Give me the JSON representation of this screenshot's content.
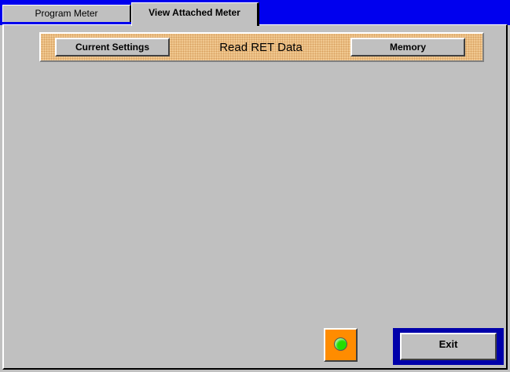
{
  "tabs": [
    {
      "label": "Program Meter",
      "active": false
    },
    {
      "label": "View Attached Meter",
      "active": true
    }
  ],
  "toolbar": {
    "current_settings_label": "Current Settings",
    "title": "Read RET Data",
    "memory_label": "Memory"
  },
  "status": {
    "led_color": "#22dd00",
    "led_box_color": "#ff8c00"
  },
  "footer": {
    "exit_label": "Exit"
  },
  "colors": {
    "tab_strip": "#0000ee",
    "panel": "#c0c0c0",
    "orange_bar": "#f0c890",
    "exit_frame": "#0000aa"
  }
}
